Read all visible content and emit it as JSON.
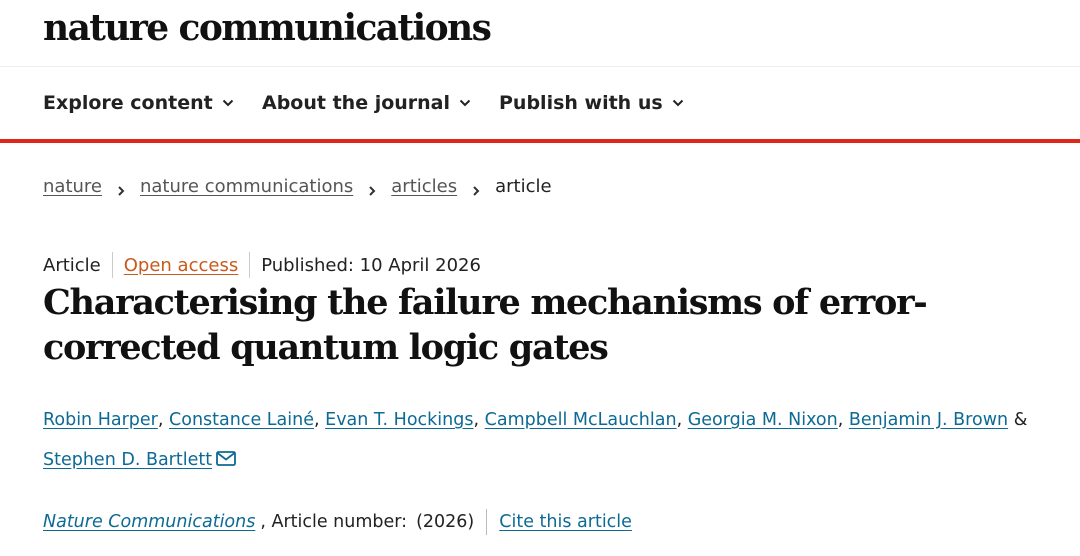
{
  "brand": {
    "logo_text": "nature communications"
  },
  "nav": {
    "items": [
      {
        "label": "Explore content"
      },
      {
        "label": "About the journal"
      },
      {
        "label": "Publish with us"
      }
    ]
  },
  "breadcrumb": {
    "items": [
      {
        "label": "nature"
      },
      {
        "label": "nature communications"
      },
      {
        "label": "articles"
      }
    ],
    "current": "article"
  },
  "meta": {
    "type": "Article",
    "access": "Open access",
    "published": "Published: 10 April 2026"
  },
  "article": {
    "title": "Characterising the failure mechanisms of error-corrected quantum logic gates"
  },
  "authors": {
    "list": [
      "Robin Harper",
      "Constance Lainé",
      "Evan T. Hockings",
      "Campbell McLauchlan",
      "Georgia M. Nixon",
      "Benjamin J. Brown",
      "Stephen D. Bartlett"
    ],
    "separator": ",",
    "conjunction": "&"
  },
  "citation": {
    "journal": "Nature Communications",
    "article_number": ", Article number:",
    "year": "(2026)",
    "cite_label": "Cite this article"
  },
  "colors": {
    "accent_red": "#e1261c",
    "link_blue": "#0c6a94",
    "open_access_orange": "#c75a1c"
  },
  "icons": {
    "nav_dropdown": "chevron-down-icon",
    "breadcrumb_separator": "chevron-right-icon",
    "corresponding_author": "envelope-icon"
  }
}
